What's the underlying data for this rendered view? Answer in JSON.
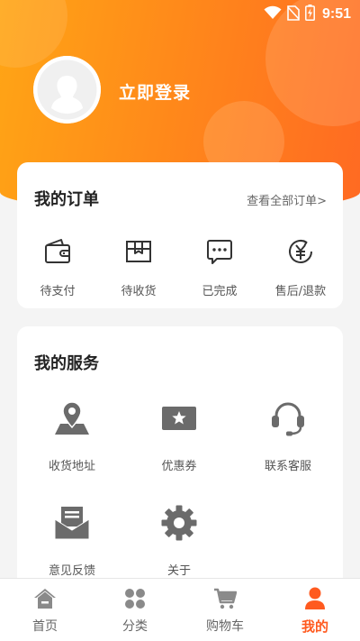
{
  "status_bar": {
    "time": "9:51"
  },
  "profile": {
    "login_label": "立即登录"
  },
  "orders": {
    "title": "我的订单",
    "view_all": "查看全部订单>",
    "items": [
      {
        "label": "待支付",
        "icon": "wallet-icon"
      },
      {
        "label": "待收货",
        "icon": "package-icon"
      },
      {
        "label": "已完成",
        "icon": "chat-dots-icon"
      },
      {
        "label": "售后/退款",
        "icon": "yuan-refund-icon"
      }
    ]
  },
  "services": {
    "title": "我的服务",
    "items": [
      {
        "label": "收货地址",
        "icon": "location-map-icon"
      },
      {
        "label": "优惠券",
        "icon": "coupon-icon"
      },
      {
        "label": "联系客服",
        "icon": "headset-icon"
      },
      {
        "label": "意见反馈",
        "icon": "mail-letter-icon"
      },
      {
        "label": "关于",
        "icon": "gear-icon"
      }
    ]
  },
  "tabbar": {
    "items": [
      {
        "label": "首页",
        "icon": "home-icon"
      },
      {
        "label": "分类",
        "icon": "grid-icon"
      },
      {
        "label": "购物车",
        "icon": "cart-icon"
      },
      {
        "label": "我的",
        "icon": "user-icon",
        "active": true
      }
    ]
  },
  "colors": {
    "accent": "#ff5a1f",
    "hero_start": "#ffa515",
    "hero_end": "#ff6a22",
    "icon_grey": "#666666"
  }
}
